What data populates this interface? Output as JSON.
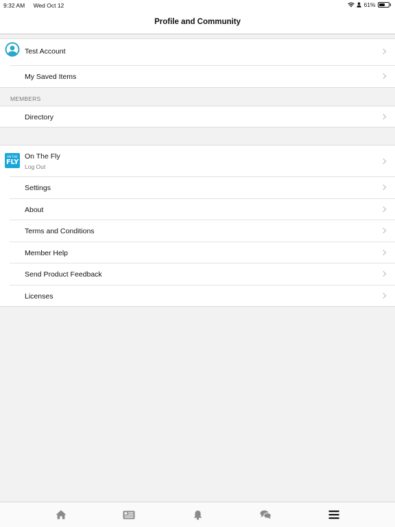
{
  "status_bar": {
    "time": "9:32 AM",
    "date": "Wed Oct 12",
    "battery": "61%",
    "battery_level": 0.61,
    "icons": [
      "wifi-icon",
      "person-icon",
      "battery-icon"
    ]
  },
  "nav": {
    "title": "Profile and Community"
  },
  "account": {
    "name": "Test Account",
    "saved_items": "My Saved Items"
  },
  "members": {
    "header": "MEMBERS",
    "directory": "Directory"
  },
  "app": {
    "name": "On The Fly",
    "logout": "Log Out",
    "logo_small": "ON THE",
    "logo_big": "FLY",
    "logo_color": "#19a6d8",
    "items": [
      {
        "label": "Settings"
      },
      {
        "label": "About"
      },
      {
        "label": "Terms and Conditions"
      },
      {
        "label": "Member Help"
      },
      {
        "label": "Send Product Feedback"
      },
      {
        "label": "Licenses"
      }
    ]
  },
  "tabs": [
    {
      "icon": "home-icon"
    },
    {
      "icon": "news-icon"
    },
    {
      "icon": "bell-icon"
    },
    {
      "icon": "chat-icon"
    },
    {
      "icon": "menu-icon",
      "active": true
    }
  ],
  "colors": {
    "active_tab": "#111111",
    "inactive_tab": "#8a8a8a"
  }
}
